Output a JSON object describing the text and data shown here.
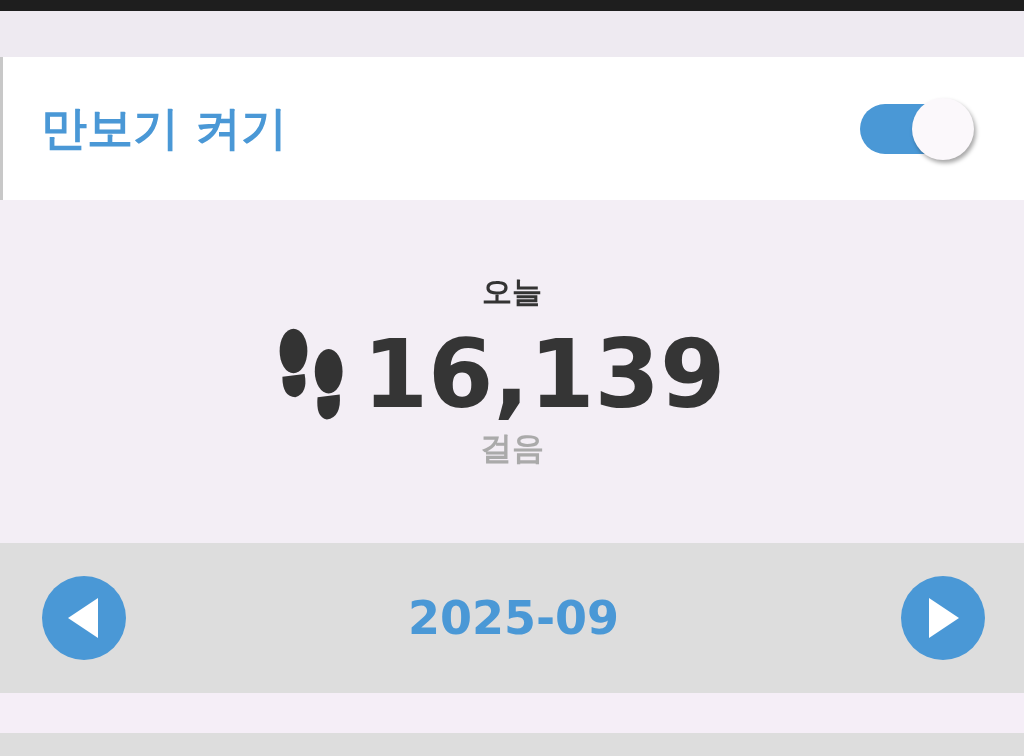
{
  "pedometer_toggle": {
    "label": "만보기 켜기",
    "on": true
  },
  "today": {
    "heading": "오늘",
    "steps": "16,139",
    "unit": "걸음"
  },
  "month_nav": {
    "month": "2025-09"
  }
}
